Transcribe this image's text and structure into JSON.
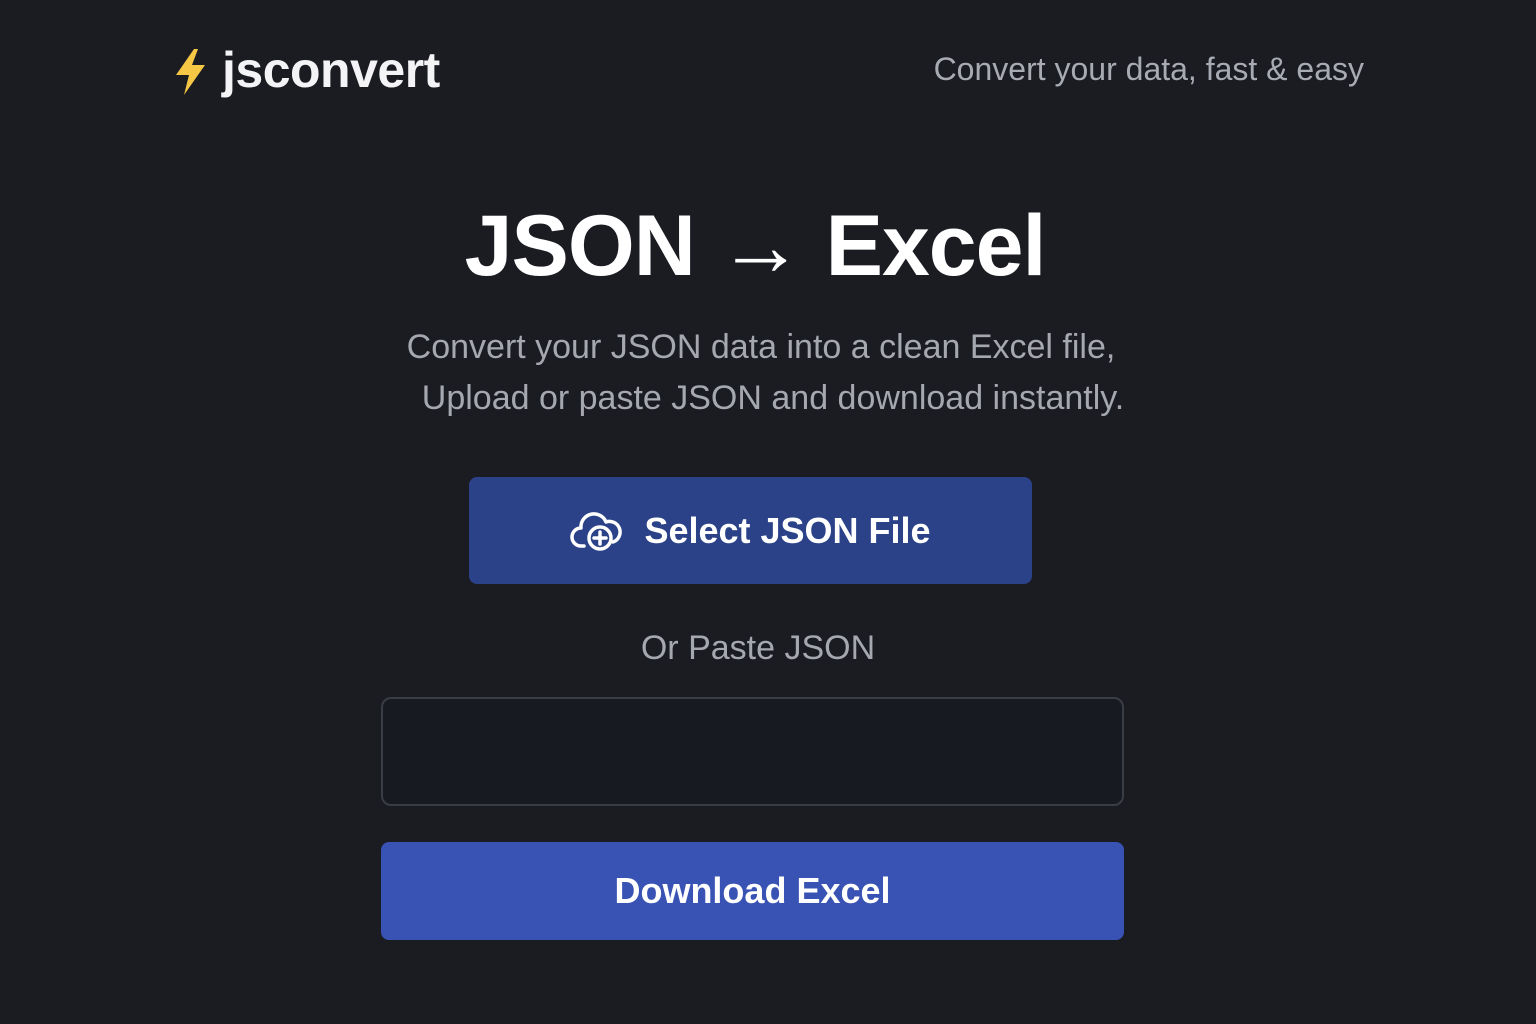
{
  "header": {
    "brand_name": "jsconvert",
    "brand_icon": "lightning-bolt-icon",
    "brand_icon_color": "#f6c744",
    "tagline": "Convert your data, fast & easy"
  },
  "hero": {
    "title": "JSON → Excel",
    "subtitle_line1": "Convert your JSON data into a clean Excel file,",
    "subtitle_line2": "Upload or paste JSON and download instantly."
  },
  "upload": {
    "button_label": "Select JSON File",
    "button_icon": "cloud-upload-icon",
    "button_color": "#2b4289"
  },
  "paste": {
    "label": "Or Paste JSON",
    "input_value": "",
    "placeholder": ""
  },
  "download": {
    "button_label": "Download Excel",
    "button_color": "#3853b4"
  },
  "colors": {
    "background": "#1a1c22",
    "muted_text": "#a6a8af"
  }
}
